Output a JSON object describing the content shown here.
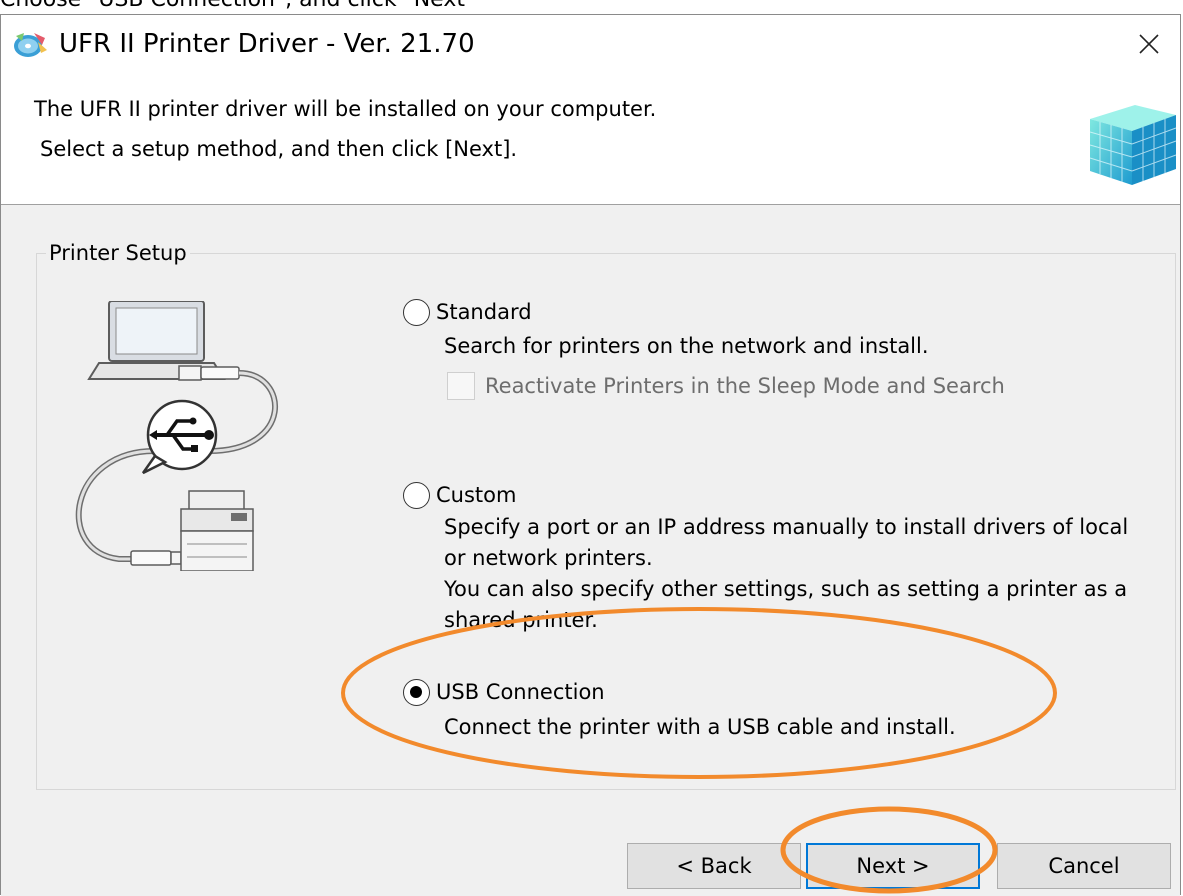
{
  "instruction": "Choose \"USB Connection\", and click \"Next\"",
  "window": {
    "title": "UFR II Printer Driver - Ver. 21.70",
    "close_icon": "close-icon",
    "app_icon": "cd-disc-icon"
  },
  "header": {
    "line1": "The UFR II printer driver will be installed on your computer.",
    "line2": "Select a setup method, and then click [Next]."
  },
  "group": {
    "title": "Printer Setup",
    "options": [
      {
        "label": "Standard",
        "description": "Search for printers on the network and install.",
        "checked": false,
        "sub_checkbox": {
          "label": "Reactivate Printers in the Sleep Mode and Search",
          "checked": false,
          "enabled": false
        }
      },
      {
        "label": "Custom",
        "description": "Specify a port or an IP address manually to install drivers of local or network printers.",
        "description2": "You can also specify other settings, such as setting a printer as a shared printer.",
        "checked": false
      },
      {
        "label": "USB Connection",
        "description": "Connect the printer with a USB cable and install.",
        "checked": true
      }
    ]
  },
  "buttons": {
    "back": "< Back",
    "next": "Next >",
    "cancel": "Cancel"
  },
  "colors": {
    "annotation": "#f28a2c",
    "default_button_border": "#0078d7",
    "body_background": "#f0f0f0"
  }
}
